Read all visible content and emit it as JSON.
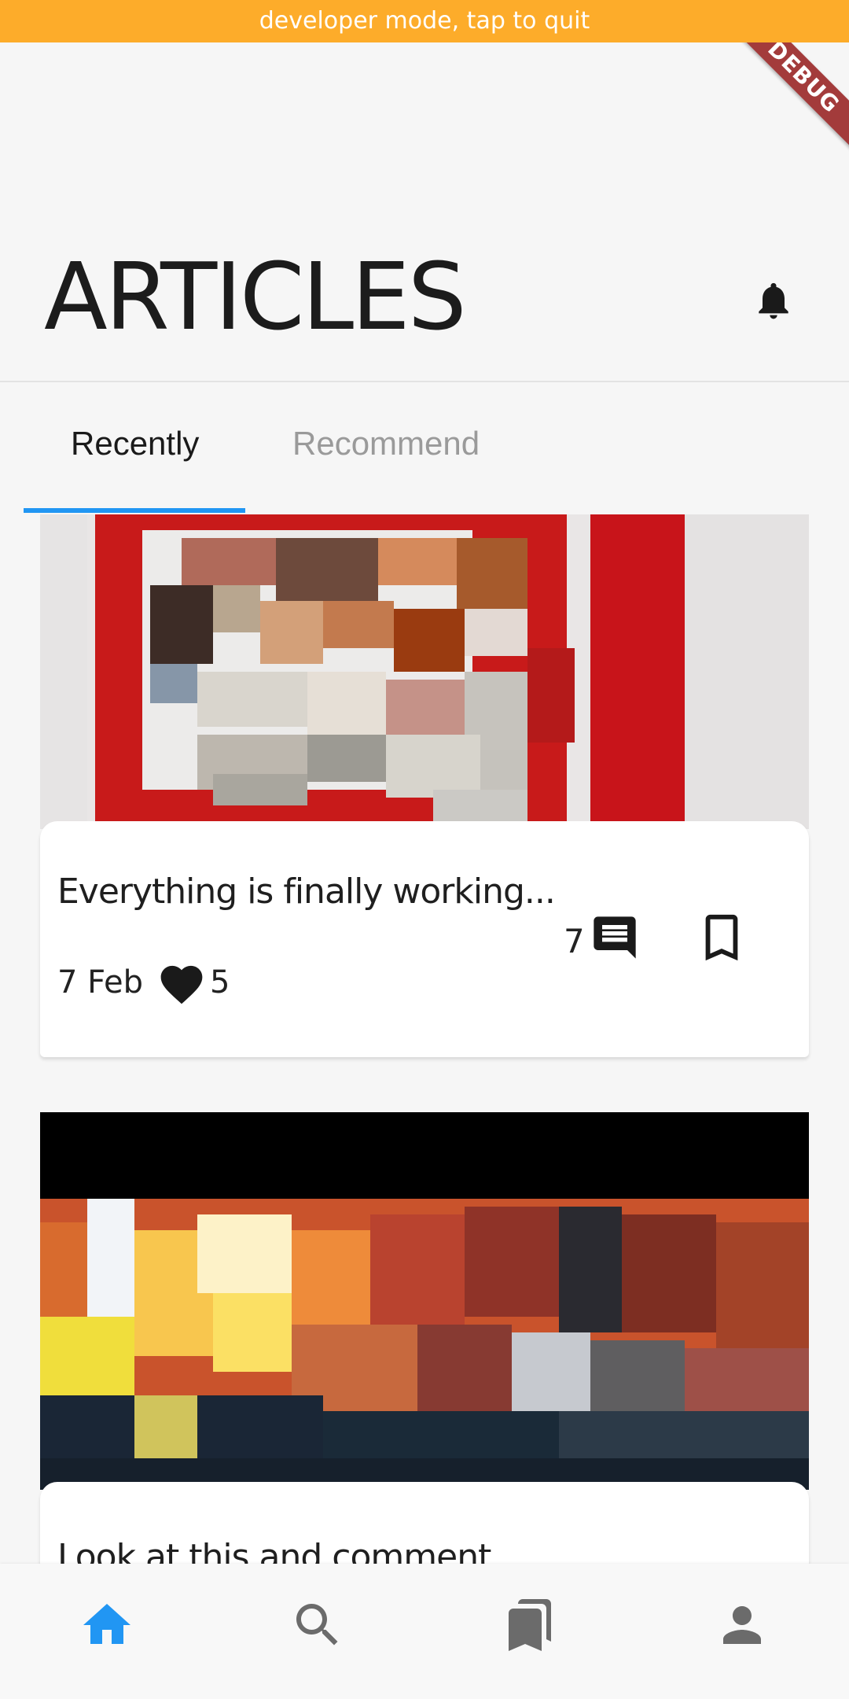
{
  "dev_banner": {
    "text": "developer mode, tap to quit"
  },
  "debug_ribbon": {
    "text": "DEBUG"
  },
  "header": {
    "title": "ARTICLES",
    "icon": "bell-icon"
  },
  "tabs": [
    {
      "label": "Recently",
      "active": true
    },
    {
      "label": "Recommend",
      "active": false
    }
  ],
  "articles": [
    {
      "title": "Everything is finally working...",
      "date": "7 Feb",
      "likes": "5",
      "comments": "7",
      "image": "pixelated-classroom-photo"
    },
    {
      "title": "Look at this and comment ...",
      "date": "",
      "likes": "",
      "comments": "",
      "image": "pixelated-sunset-photo"
    }
  ],
  "bottom_nav": [
    {
      "icon": "home-icon",
      "active": true
    },
    {
      "icon": "search-icon",
      "active": false
    },
    {
      "icon": "bookmarks-icon",
      "active": false
    },
    {
      "icon": "person-icon",
      "active": false
    }
  ],
  "colors": {
    "dev_banner": "#FDAC2A",
    "accent": "#2196F3",
    "debug_ribbon": "#A33B3B",
    "inactive_icon": "#6b6b6b"
  }
}
